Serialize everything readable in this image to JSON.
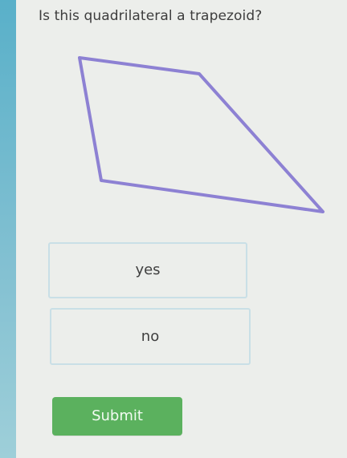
{
  "question": {
    "text": "Is this quadrilateral a trapezoid?"
  },
  "figure": {
    "shape": "quadrilateral",
    "stroke_color": "#8d81d3"
  },
  "choices": [
    {
      "label": "yes"
    },
    {
      "label": "no"
    }
  ],
  "submit": {
    "label": "Submit",
    "color": "#5bb15e"
  }
}
